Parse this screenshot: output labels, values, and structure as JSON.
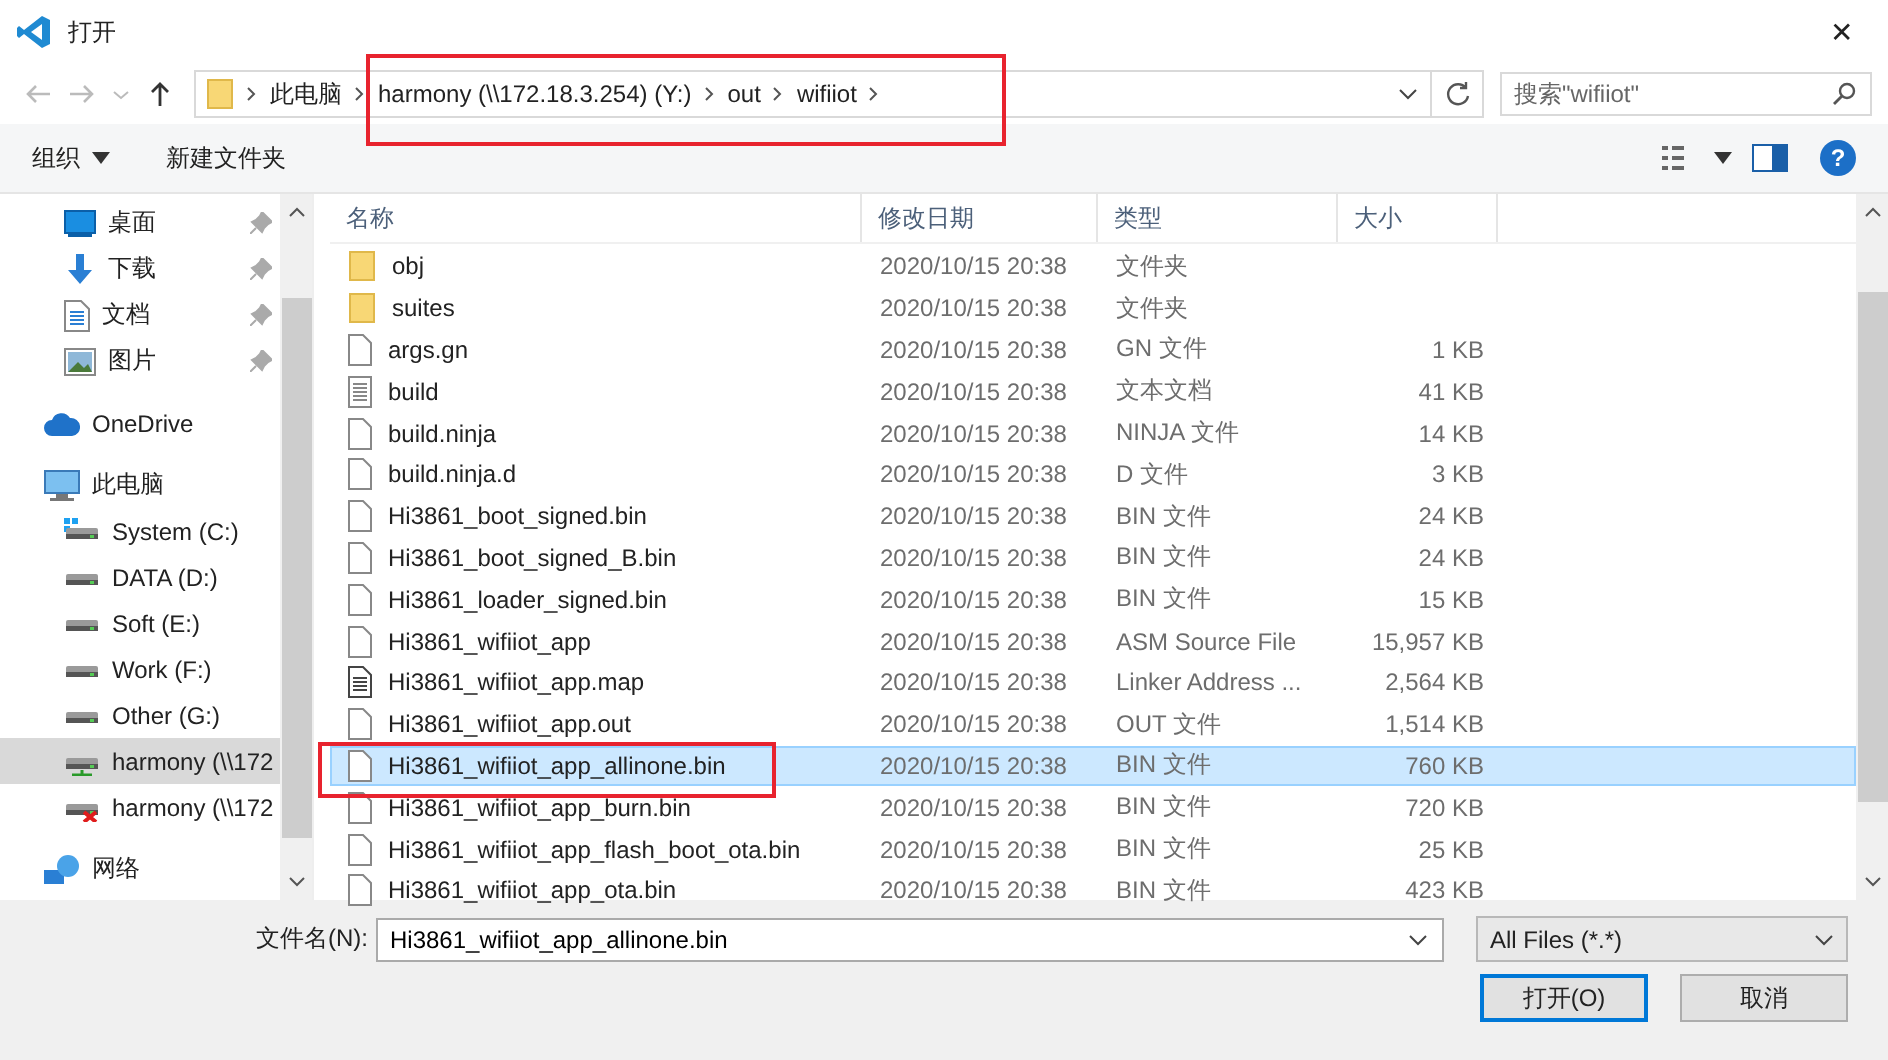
{
  "window": {
    "title": "打开",
    "close": "✕"
  },
  "address_bar": {
    "crumbs": [
      "此电脑",
      "harmony (\\\\172.18.3.254) (Y:)",
      "out",
      "wifiiot"
    ]
  },
  "search": {
    "placeholder": "搜索\"wifiiot\""
  },
  "toolbar": {
    "organize": "组织",
    "new_folder": "新建文件夹",
    "help": "?"
  },
  "sidebar": {
    "items": [
      {
        "label": "桌面",
        "kind": "desktop",
        "pinned": true,
        "selected": false
      },
      {
        "label": "下载",
        "kind": "download",
        "pinned": true,
        "selected": false
      },
      {
        "label": "文档",
        "kind": "document",
        "pinned": true,
        "selected": false
      },
      {
        "label": "图片",
        "kind": "pictures",
        "pinned": true,
        "selected": false
      },
      {
        "label": "OneDrive",
        "kind": "cloud",
        "pinned": false,
        "selected": false
      },
      {
        "label": "此电脑",
        "kind": "computer",
        "pinned": false,
        "selected": false
      },
      {
        "label": "System (C:)",
        "kind": "system-drive",
        "pinned": false,
        "selected": false
      },
      {
        "label": "DATA (D:)",
        "kind": "drive",
        "pinned": false,
        "selected": false
      },
      {
        "label": "Soft (E:)",
        "kind": "drive",
        "pinned": false,
        "selected": false
      },
      {
        "label": "Work (F:)",
        "kind": "drive",
        "pinned": false,
        "selected": false
      },
      {
        "label": "Other (G:)",
        "kind": "drive",
        "pinned": false,
        "selected": false
      },
      {
        "label": "harmony (\\\\172",
        "kind": "network-drive",
        "pinned": false,
        "selected": true
      },
      {
        "label": "harmony (\\\\172",
        "kind": "disconnected-drive",
        "pinned": false,
        "selected": false
      },
      {
        "label": "网络",
        "kind": "network",
        "pinned": false,
        "selected": false
      }
    ]
  },
  "table": {
    "columns": [
      "名称",
      "修改日期",
      "类型",
      "大小"
    ],
    "rows": [
      {
        "name": "obj",
        "kind": "folder",
        "date": "2020/10/15 20:38",
        "type": "文件夹",
        "size": "",
        "selected": false
      },
      {
        "name": "suites",
        "kind": "folder",
        "date": "2020/10/15 20:38",
        "type": "文件夹",
        "size": "",
        "selected": false
      },
      {
        "name": "args.gn",
        "kind": "file",
        "date": "2020/10/15 20:38",
        "type": "GN 文件",
        "size": "1 KB",
        "selected": false
      },
      {
        "name": "build",
        "kind": "text",
        "date": "2020/10/15 20:38",
        "type": "文本文档",
        "size": "41 KB",
        "selected": false
      },
      {
        "name": "build.ninja",
        "kind": "file",
        "date": "2020/10/15 20:38",
        "type": "NINJA 文件",
        "size": "14 KB",
        "selected": false
      },
      {
        "name": "build.ninja.d",
        "kind": "file",
        "date": "2020/10/15 20:38",
        "type": "D 文件",
        "size": "3 KB",
        "selected": false
      },
      {
        "name": "Hi3861_boot_signed.bin",
        "kind": "file",
        "date": "2020/10/15 20:38",
        "type": "BIN 文件",
        "size": "24 KB",
        "selected": false
      },
      {
        "name": "Hi3861_boot_signed_B.bin",
        "kind": "file",
        "date": "2020/10/15 20:38",
        "type": "BIN 文件",
        "size": "24 KB",
        "selected": false
      },
      {
        "name": "Hi3861_loader_signed.bin",
        "kind": "file",
        "date": "2020/10/15 20:38",
        "type": "BIN 文件",
        "size": "15 KB",
        "selected": false
      },
      {
        "name": "Hi3861_wifiiot_app",
        "kind": "file",
        "date": "2020/10/15 20:38",
        "type": "ASM Source File",
        "size": "15,957 KB",
        "selected": false
      },
      {
        "name": "Hi3861_wifiiot_app.map",
        "kind": "map",
        "date": "2020/10/15 20:38",
        "type": "Linker Address ...",
        "size": "2,564 KB",
        "selected": false
      },
      {
        "name": "Hi3861_wifiiot_app.out",
        "kind": "file",
        "date": "2020/10/15 20:38",
        "type": "OUT 文件",
        "size": "1,514 KB",
        "selected": false
      },
      {
        "name": "Hi3861_wifiiot_app_allinone.bin",
        "kind": "file",
        "date": "2020/10/15 20:38",
        "type": "BIN 文件",
        "size": "760 KB",
        "selected": true
      },
      {
        "name": "Hi3861_wifiiot_app_burn.bin",
        "kind": "file",
        "date": "2020/10/15 20:38",
        "type": "BIN 文件",
        "size": "720 KB",
        "selected": false
      },
      {
        "name": "Hi3861_wifiiot_app_flash_boot_ota.bin",
        "kind": "file",
        "date": "2020/10/15 20:38",
        "type": "BIN 文件",
        "size": "25 KB",
        "selected": false
      },
      {
        "name": "Hi3861_wifiiot_app_ota.bin",
        "kind": "file",
        "date": "2020/10/15 20:38",
        "type": "BIN 文件",
        "size": "423 KB",
        "selected": false
      }
    ]
  },
  "footer": {
    "filename_label": "文件名(N):",
    "filename": "Hi3861_wifiiot_app_allinone.bin",
    "filter": "All Files (*.*)",
    "open": "打开(O)",
    "cancel": "取消"
  }
}
